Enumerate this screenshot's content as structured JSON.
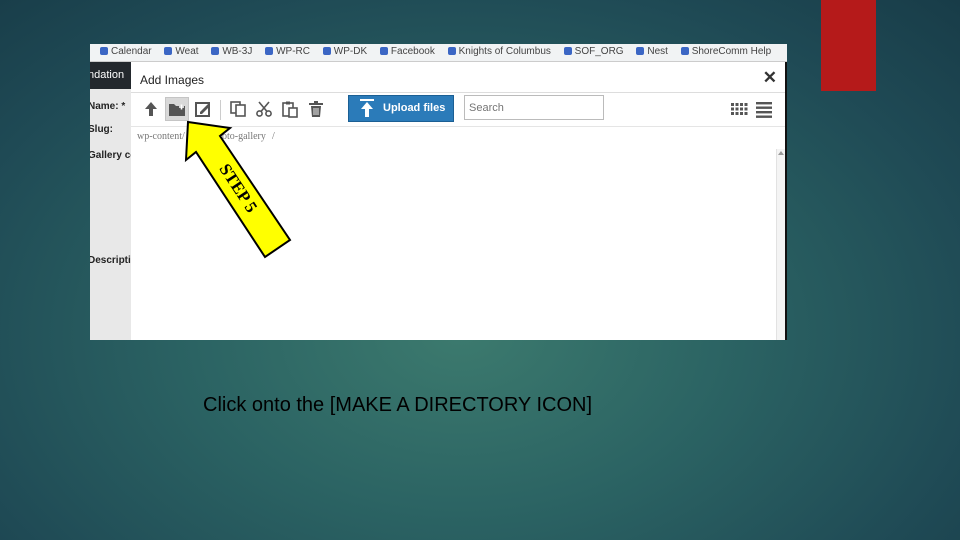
{
  "colors": {
    "background": "#2b6363",
    "red_tab": "#b51a1a",
    "upload_button": "#2b7bb9",
    "callout_fill": "#ffff00"
  },
  "bookmarks": [
    "Calendar",
    "Weat",
    "WB-3J",
    "WP-RC",
    "WP-DK",
    "Facebook",
    "Knights of Columbus",
    "SOF_ORG",
    "Nest",
    "ShoreComm Help"
  ],
  "left_pane": {
    "header": "ndation",
    "name_label": "Name: *",
    "slug_label": "Slug:",
    "gallery_label": "Gallery co",
    "description_label": "Descriptio"
  },
  "dialog": {
    "title": "Add Images",
    "close_icon": "close-icon",
    "toolbar": {
      "icons": [
        "arrow-up-icon",
        "make-directory-icon",
        "edit-icon",
        "copy-icon",
        "cut-icon",
        "paste-icon",
        "trash-icon"
      ],
      "upload_label": "Upload files",
      "upload_icon": "upload-arrow-icon",
      "search_placeholder": "Search",
      "view_icons": [
        "grid-view-icon",
        "list-view-icon"
      ]
    },
    "breadcrumb": {
      "root": "wp-content/",
      "current": "photo-gallery",
      "separator": "/"
    }
  },
  "callout": {
    "text": "STEP 5"
  },
  "caption": "Click onto the [MAKE A DIRECTORY ICON]"
}
